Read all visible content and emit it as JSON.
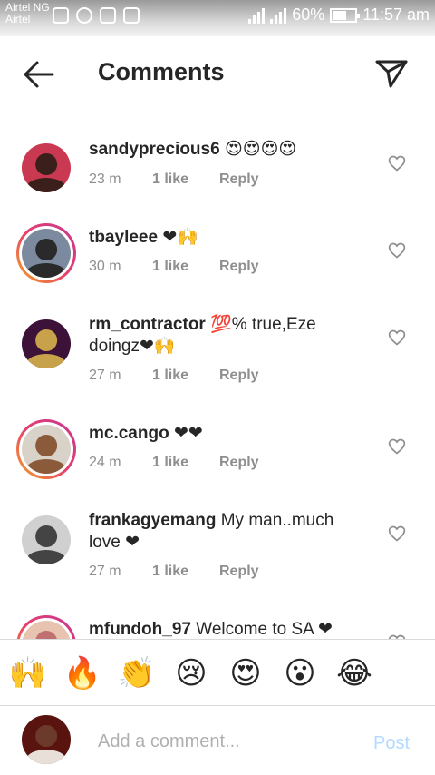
{
  "status_bar": {
    "carrier_top": "Airtel NG",
    "carrier_bottom": "Airtel",
    "battery": "60%",
    "battery_level": 0.6,
    "time": "11:57 am"
  },
  "header": {
    "title": "Comments"
  },
  "comments": [
    {
      "username": "sandyprecious6",
      "text": "😍😍😍😍",
      "time": "23 m",
      "likes": "1 like",
      "reply": "Reply",
      "ring": false,
      "avatar_colors": [
        "#c93a52",
        "#3a1f1a"
      ]
    },
    {
      "username": "tbayleee",
      "text": "❤🙌",
      "time": "30 m",
      "likes": "1 like",
      "reply": "Reply",
      "ring": true,
      "avatar_colors": [
        "#7c8aa0",
        "#2a2a2a"
      ]
    },
    {
      "username": "rm_contractor",
      "text": "💯% true,Eze doingz❤🙌",
      "time": "27 m",
      "likes": "1 like",
      "reply": "Reply",
      "ring": false,
      "avatar_colors": [
        "#3c1238",
        "#c8a24a"
      ]
    },
    {
      "username": "mc.cango",
      "text": "❤❤",
      "time": "24 m",
      "likes": "1 like",
      "reply": "Reply",
      "ring": true,
      "avatar_colors": [
        "#d8d2c8",
        "#8a5a3a"
      ]
    },
    {
      "username": "frankagyemang",
      "text": "My man..much love ❤",
      "time": "27 m",
      "likes": "1 like",
      "reply": "Reply",
      "ring": false,
      "avatar_colors": [
        "#d0d0d0",
        "#444444"
      ]
    },
    {
      "username": "mfundoh_97",
      "text": "Welcome to SA ❤",
      "time": "",
      "likes": "",
      "reply": "",
      "ring": true,
      "avatar_colors": [
        "#e8c4b0",
        "#c07070"
      ]
    }
  ],
  "emoji_bar": [
    "🙌",
    "🔥",
    "👏",
    "😢",
    "😍",
    "😮",
    "😂"
  ],
  "composer": {
    "placeholder": "Add a comment...",
    "post_label": "Post"
  },
  "colors": {
    "text": "#262626",
    "meta": "#8e8e8e",
    "post_disabled": "#b3dbff",
    "story_ring": "#e63f6d"
  }
}
